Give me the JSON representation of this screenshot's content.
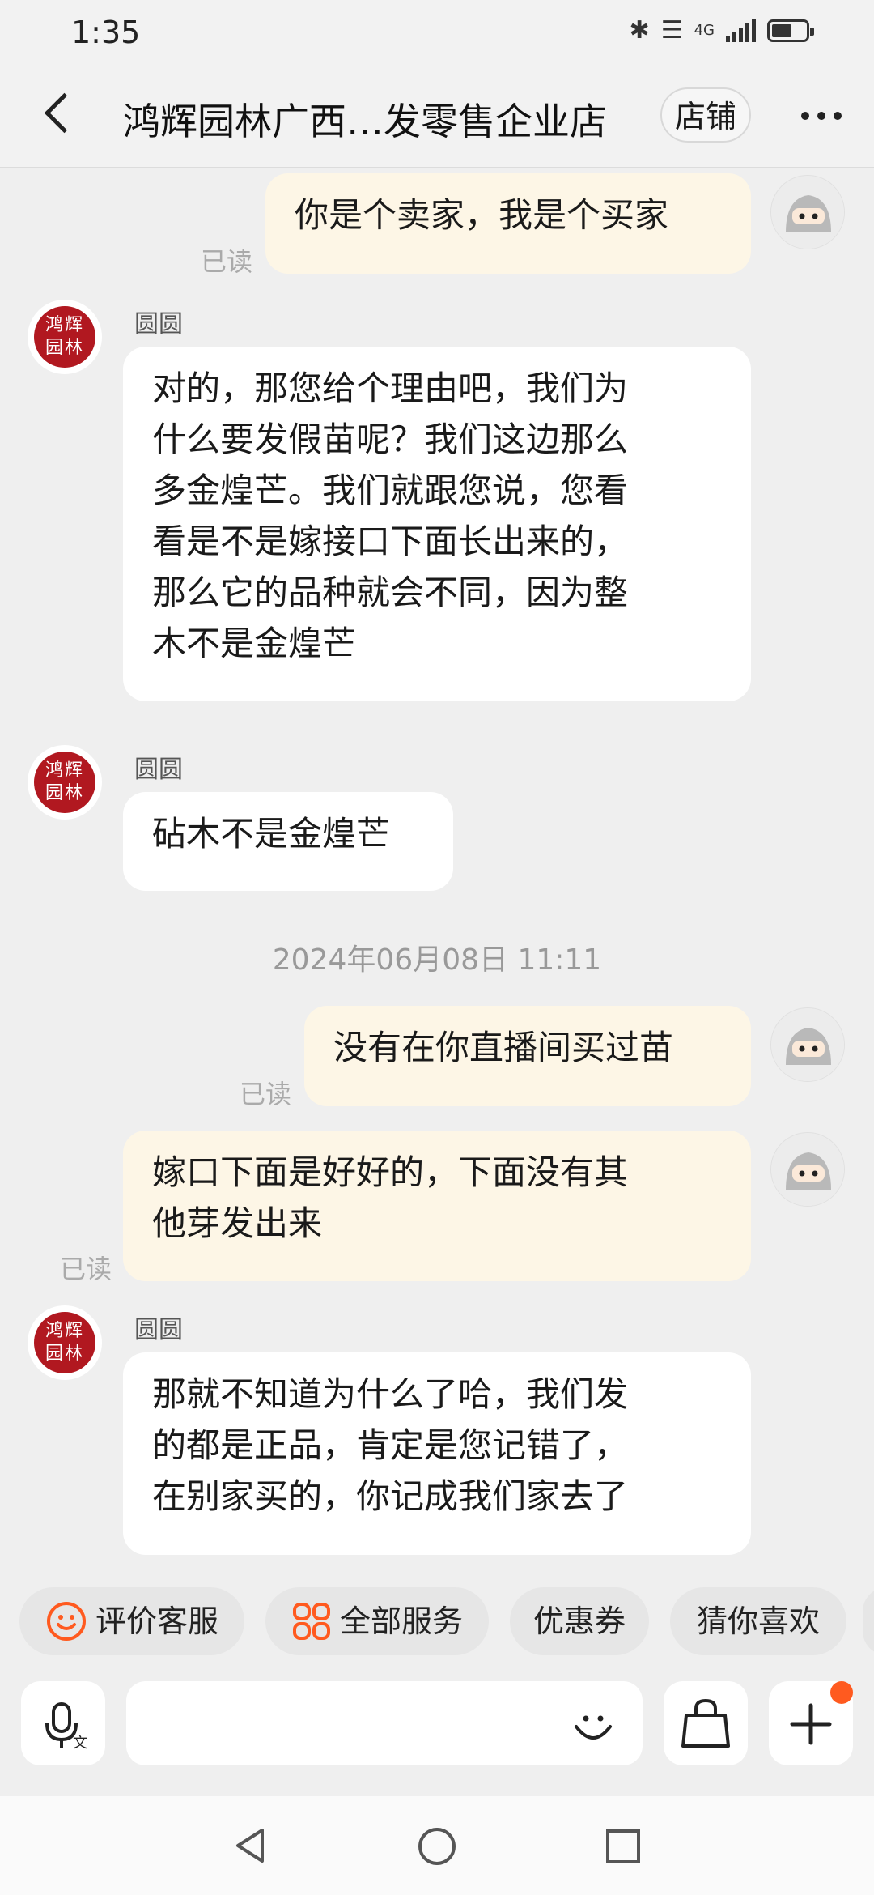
{
  "status_bar": {
    "time": "1:35",
    "network": "4G"
  },
  "header": {
    "title": "鸿辉园林广西…发零售企业店",
    "shop_button": "店铺"
  },
  "shop_logo_text": "鸿辉园林",
  "messages": [
    {
      "side": "out",
      "text": "你是个卖家，我是个买家",
      "read": "已读"
    },
    {
      "side": "in",
      "sender": "圆圆",
      "lines": [
        "对的，那您给个理由吧，我们为",
        "什么要发假苗呢？我们这边那么",
        "多金煌芒。我们就跟您说，您看",
        "看是不是嫁接口下面长出来的，",
        "那么它的品种就会不同，因为整",
        "木不是金煌芒"
      ]
    },
    {
      "side": "in",
      "sender": "圆圆",
      "text": "砧木不是金煌芒"
    },
    {
      "timestamp": "2024年06月08日 11:11"
    },
    {
      "side": "out",
      "text": "没有在你直播间买过苗",
      "read": "已读"
    },
    {
      "side": "out",
      "lines": [
        "嫁口下面是好好的，下面没有其",
        "他芽发出来"
      ],
      "read": "已读"
    },
    {
      "side": "in",
      "sender": "圆圆",
      "lines": [
        "那就不知道为什么了哈，我们发",
        "的都是正品，肯定是您记错了，",
        "在别家买的，你记成我们家去了"
      ]
    }
  ],
  "quick_actions": [
    "评价客服",
    "全部服务",
    "优惠券",
    "猜你喜欢"
  ],
  "input": {
    "placeholder": ""
  },
  "colors": {
    "accent": "#ff5a1f",
    "outgoing_bubble": "#fdf6e6",
    "incoming_bubble": "#ffffff",
    "background": "#efefef",
    "seal_red": "#b11820"
  }
}
